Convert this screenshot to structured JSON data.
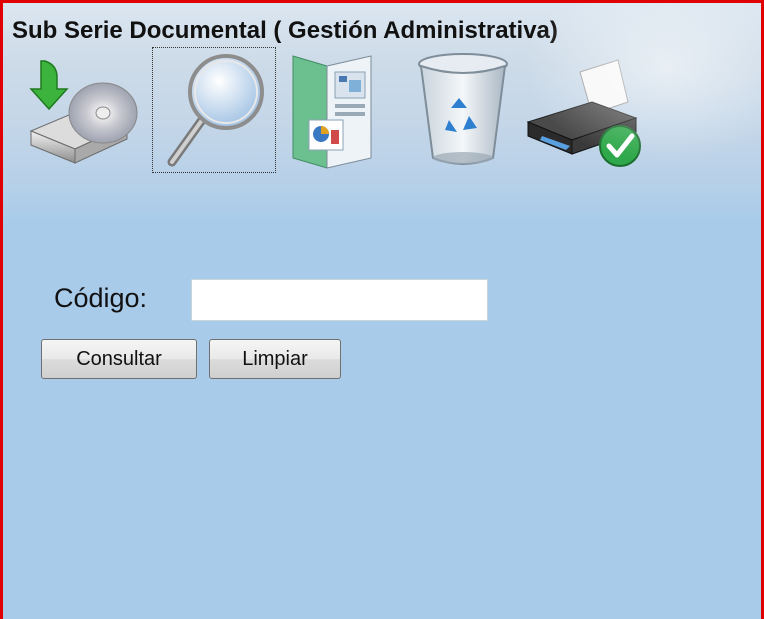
{
  "page": {
    "title": "Sub Serie Documental ( Gestión Administrativa)"
  },
  "toolbar": {
    "buttons": [
      {
        "icon": "save-to-disk-icon"
      },
      {
        "icon": "magnifier-icon"
      },
      {
        "icon": "documents-icon"
      },
      {
        "icon": "recycle-bin-icon"
      },
      {
        "icon": "printer-icon"
      }
    ]
  },
  "form": {
    "codigo_label": "Código:",
    "codigo_value": "",
    "consultar_label": "Consultar",
    "limpiar_label": "Limpiar"
  },
  "colors": {
    "border": "#e00000",
    "content_background": "#a8cbea"
  }
}
